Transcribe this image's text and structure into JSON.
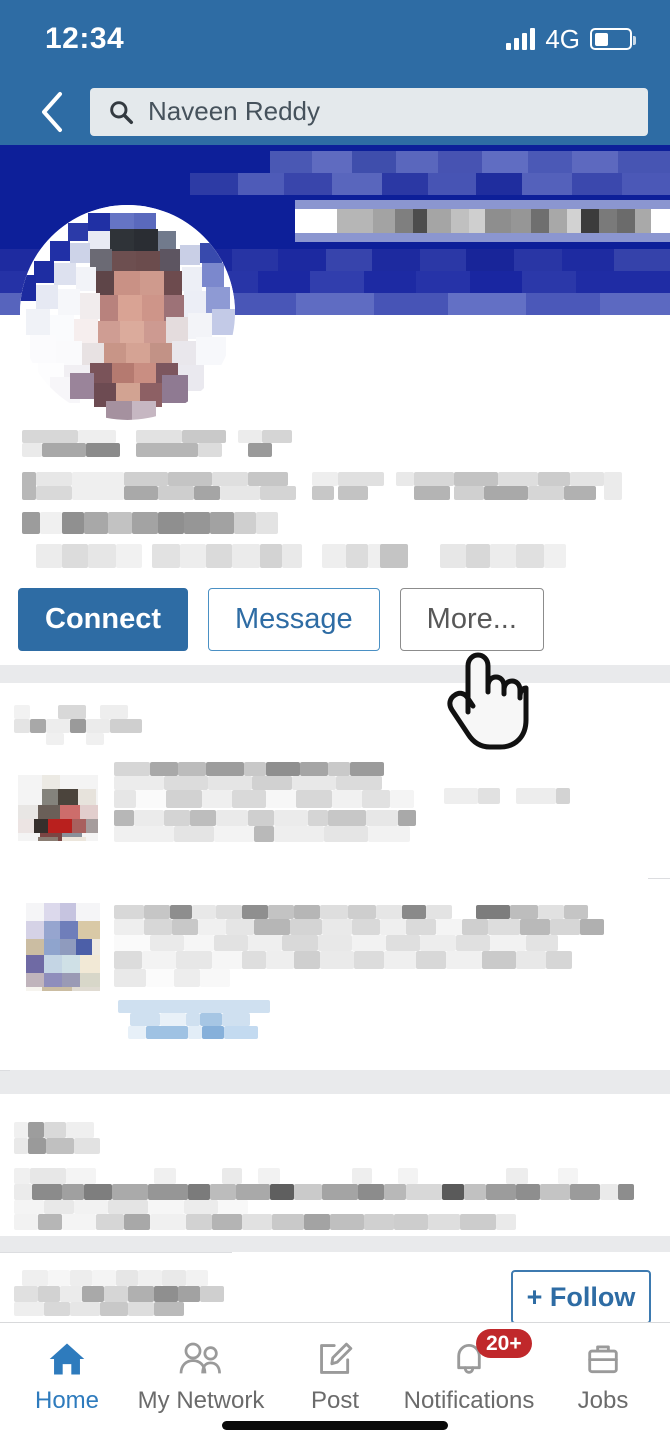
{
  "status_bar": {
    "time": "12:34",
    "carrier": "4G",
    "signal_icon": "signal-bars-icon",
    "battery_icon": "battery-icon",
    "battery_level_percent": 42
  },
  "search": {
    "back_icon": "back-chevron-icon",
    "search_icon": "search-icon",
    "query": "Naveen Reddy",
    "placeholder": "Search"
  },
  "profile": {
    "cover_photo": "redacted-cover-photo",
    "avatar": "redacted-profile-avatar",
    "name": "",
    "headline": "",
    "location": "",
    "connections": "",
    "redacted": true
  },
  "actions": {
    "connect_label": "Connect",
    "message_label": "Message",
    "more_label": "More..."
  },
  "feed": {
    "sections": [
      {
        "heading": "",
        "thumbnail": "redacted-thumbnail",
        "lines": 3,
        "redacted": true
      },
      {
        "heading": "",
        "thumbnail": "redacted-thumbnail",
        "lines": 3,
        "tag": "redacted-link-tag",
        "redacted": true
      },
      {
        "heading": "",
        "lines": 2,
        "redacted": true
      }
    ]
  },
  "follow": {
    "label": "+ Follow",
    "entity": "",
    "redacted": true
  },
  "bottom_nav": {
    "items": [
      {
        "label": "Home",
        "icon": "home-icon",
        "active": true,
        "badge": ""
      },
      {
        "label": "My Network",
        "icon": "people-icon",
        "active": false,
        "badge": ""
      },
      {
        "label": "Post",
        "icon": "compose-icon",
        "active": false,
        "badge": ""
      },
      {
        "label": "Notifications",
        "icon": "bell-icon",
        "active": false,
        "badge": "20+"
      },
      {
        "label": "Jobs",
        "icon": "briefcase-icon",
        "active": false,
        "badge": ""
      }
    ]
  },
  "cursor": {
    "icon": "pointing-hand-cursor"
  },
  "colors": {
    "header_blue": "#2e6ca4",
    "cover_blue": "#0d1f99",
    "accent_blue": "#2e7bbd",
    "badge_red": "#c0282b",
    "search_field": "#e4e9ec",
    "divider": "#e9eaec"
  }
}
